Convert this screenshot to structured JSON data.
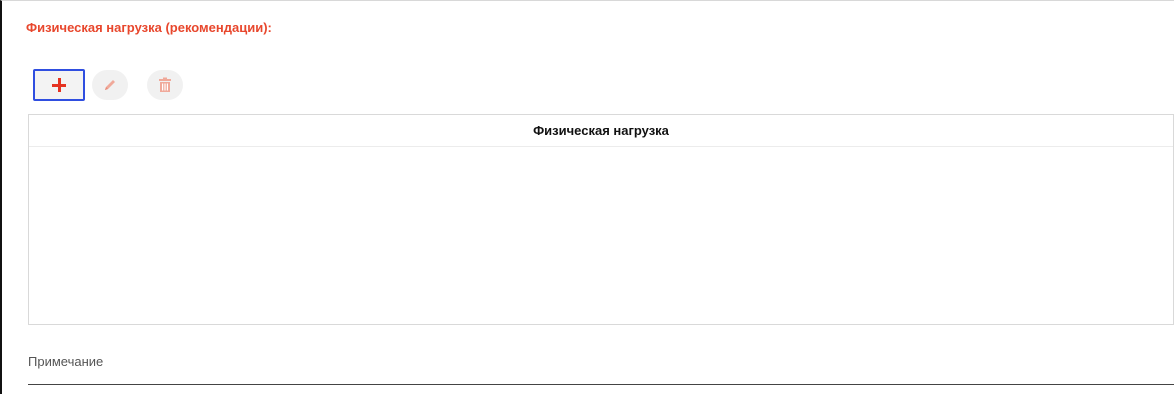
{
  "section": {
    "title": "Физическая нагрузка (рекомендации):"
  },
  "toolbar": {
    "add_icon": "plus-icon",
    "edit_icon": "pencil-icon",
    "delete_icon": "trash-icon",
    "accent_color": "#e53321",
    "focus_color": "#2f4ee0"
  },
  "grid": {
    "columns": [
      "Физическая нагрузка"
    ],
    "rows": []
  },
  "note": {
    "label": "Примечание",
    "value": ""
  }
}
